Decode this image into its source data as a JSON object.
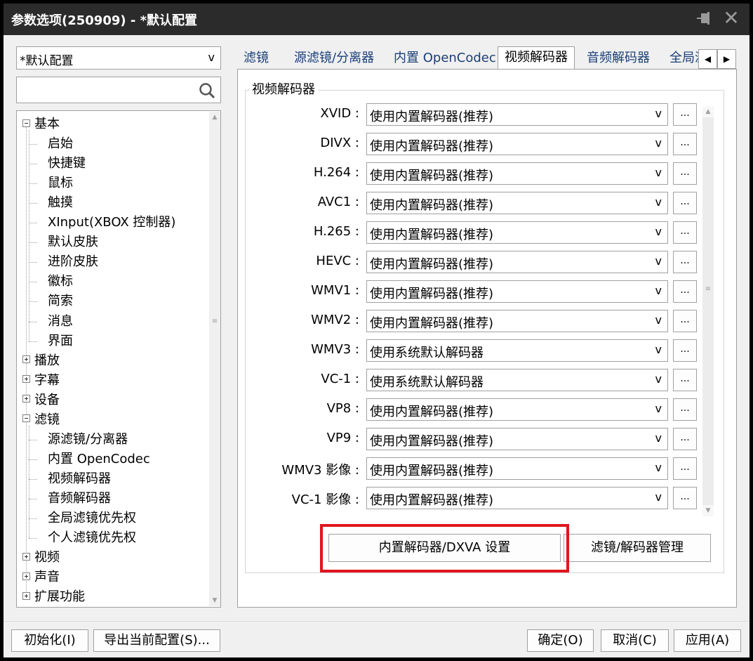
{
  "window": {
    "title": "参数选项(250909) - *默认配置",
    "pin_icon": "pin-icon",
    "close_icon": "close-icon",
    "close_glyph": "✕"
  },
  "profile": {
    "selected": "*默认配置",
    "arrow": "v"
  },
  "search": {
    "value": "",
    "icon": "search-icon"
  },
  "tree": [
    {
      "label": "基本",
      "level": 0,
      "toggle": "minus"
    },
    {
      "label": "启始",
      "level": 1
    },
    {
      "label": "快捷键",
      "level": 1
    },
    {
      "label": "鼠标",
      "level": 1
    },
    {
      "label": "触摸",
      "level": 1
    },
    {
      "label": "XInput(XBOX 控制器)",
      "level": 1
    },
    {
      "label": "默认皮肤",
      "level": 1
    },
    {
      "label": "进阶皮肤",
      "level": 1
    },
    {
      "label": "徽标",
      "level": 1
    },
    {
      "label": "简索",
      "level": 1
    },
    {
      "label": "消息",
      "level": 1
    },
    {
      "label": "界面",
      "level": 1
    },
    {
      "label": "播放",
      "level": 0,
      "toggle": "plus"
    },
    {
      "label": "字幕",
      "level": 0,
      "toggle": "plus"
    },
    {
      "label": "设备",
      "level": 0,
      "toggle": "plus"
    },
    {
      "label": "滤镜",
      "level": 0,
      "toggle": "minus"
    },
    {
      "label": "源滤镜/分离器",
      "level": 1
    },
    {
      "label": "内置 OpenCodec",
      "level": 1
    },
    {
      "label": "视频解码器",
      "level": 1,
      "selected": true
    },
    {
      "label": "音频解码器",
      "level": 1
    },
    {
      "label": "全局滤镜优先权",
      "level": 1
    },
    {
      "label": "个人滤镜优先权",
      "level": 1
    },
    {
      "label": "视频",
      "level": 0,
      "toggle": "plus"
    },
    {
      "label": "声音",
      "level": 0,
      "toggle": "plus"
    },
    {
      "label": "扩展功能",
      "level": 0,
      "toggle": "plus"
    }
  ],
  "tabs": [
    {
      "label": "滤镜",
      "active": false
    },
    {
      "label": "源滤镜/分离器",
      "active": false
    },
    {
      "label": "内置 OpenCodec",
      "active": false
    },
    {
      "label": "视频解码器",
      "active": true
    },
    {
      "label": "音频解码器",
      "active": false
    },
    {
      "label": "全局滤",
      "active": false
    }
  ],
  "tab_nav": {
    "prev": "◀",
    "next": "▶"
  },
  "group": {
    "title": "视频解码器"
  },
  "decoders": [
    {
      "label": "XVID :",
      "value": "使用内置解码器(推荐)"
    },
    {
      "label": "DIVX :",
      "value": "使用内置解码器(推荐)"
    },
    {
      "label": "H.264 :",
      "value": "使用内置解码器(推荐)"
    },
    {
      "label": "AVC1 :",
      "value": "使用内置解码器(推荐)"
    },
    {
      "label": "H.265 :",
      "value": "使用内置解码器(推荐)"
    },
    {
      "label": "HEVC :",
      "value": "使用内置解码器(推荐)"
    },
    {
      "label": "WMV1 :",
      "value": "使用内置解码器(推荐)"
    },
    {
      "label": "WMV2 :",
      "value": "使用内置解码器(推荐)"
    },
    {
      "label": "WMV3 :",
      "value": "使用系统默认解码器"
    },
    {
      "label": "VC-1 :",
      "value": "使用系统默认解码器"
    },
    {
      "label": "VP8 :",
      "value": "使用内置解码器(推荐)"
    },
    {
      "label": "VP9 :",
      "value": "使用内置解码器(推荐)"
    },
    {
      "label": "WMV3 影像 :",
      "value": "使用内置解码器(推荐)"
    },
    {
      "label": "VC-1 影像 :",
      "value": "使用内置解码器(推荐)"
    }
  ],
  "dropdown_arrow": "v",
  "more_label": "...",
  "buttons": {
    "dxva": "内置解码器/DXVA 设置",
    "filter_mgr": "滤镜/解码器管理",
    "init": "初始化(I)",
    "export": "导出当前配置(S)...",
    "ok": "确定(O)",
    "cancel": "取消(C)",
    "apply": "应用(A)"
  },
  "colors": {
    "highlight": "#e0161e",
    "titlebar": "#2b2b2b",
    "tab_text": "#1a3f7a"
  }
}
